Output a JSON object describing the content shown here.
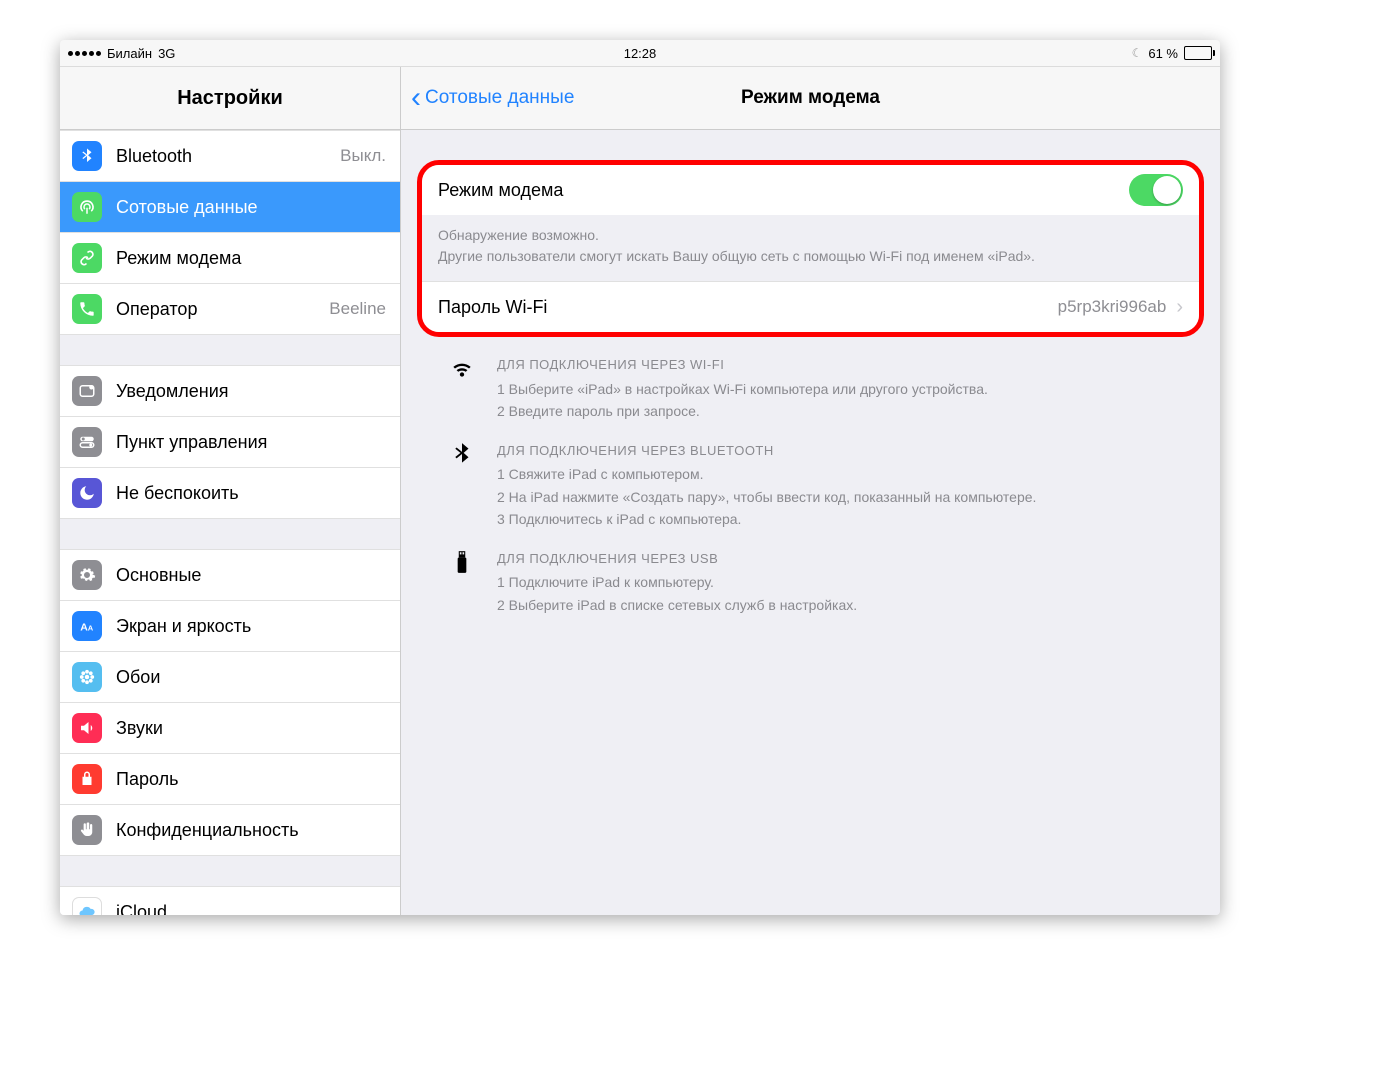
{
  "status": {
    "carrier": "Билайн",
    "network": "3G",
    "time": "12:28",
    "battery_pct": "61 %",
    "battery_level": 61
  },
  "sidebar": {
    "title": "Настройки",
    "groups": [
      {
        "rows": [
          {
            "id": "bluetooth",
            "label": "Bluetooth",
            "value": "Выкл.",
            "icon": "bluetooth",
            "color": "#2183ff"
          },
          {
            "id": "cellular",
            "label": "Сотовые данные",
            "icon": "antenna",
            "color": "#4cd964",
            "selected": true
          },
          {
            "id": "hotspot",
            "label": "Режим модема",
            "icon": "link",
            "color": "#4cd964"
          },
          {
            "id": "carrier",
            "label": "Оператор",
            "value": "Beeline",
            "icon": "phone",
            "color": "#4cd964"
          }
        ]
      },
      {
        "rows": [
          {
            "id": "notif",
            "label": "Уведомления",
            "icon": "notif",
            "color": "#8e8e93"
          },
          {
            "id": "control",
            "label": "Пункт управления",
            "icon": "switches",
            "color": "#8e8e93"
          },
          {
            "id": "dnd",
            "label": "Не беспокоить",
            "icon": "moon",
            "color": "#5856d6"
          }
        ]
      },
      {
        "rows": [
          {
            "id": "general",
            "label": "Основные",
            "icon": "gear",
            "color": "#8e8e93"
          },
          {
            "id": "display",
            "label": "Экран и яркость",
            "icon": "aa",
            "color": "#2183ff"
          },
          {
            "id": "wallpaper",
            "label": "Обои",
            "icon": "flower",
            "color": "#55bef0"
          },
          {
            "id": "sounds",
            "label": "Звуки",
            "icon": "speaker",
            "color": "#ff2d55"
          },
          {
            "id": "passcode",
            "label": "Пароль",
            "icon": "lock",
            "color": "#ff3b30"
          },
          {
            "id": "privacy",
            "label": "Конфиденциальность",
            "icon": "hand",
            "color": "#8e8e93"
          }
        ]
      },
      {
        "rows": [
          {
            "id": "icloud",
            "label": "iCloud",
            "icon": "cloud",
            "color": "#ffffff"
          }
        ]
      }
    ]
  },
  "detail": {
    "back": "Сотовые данные",
    "title": "Режим модема",
    "hotspot_label": "Режим модема",
    "hotspot_on": true,
    "footer_line1": "Обнаружение возможно.",
    "footer_line2": "Другие пользователи смогут искать Вашу общую сеть с помощью Wi-Fi под именем «iPad».",
    "password_label": "Пароль Wi-Fi",
    "password_value": "p5rp3kri996ab",
    "instructions": [
      {
        "icon": "wifi",
        "heading": "ДЛЯ ПОДКЛЮЧЕНИЯ ЧЕРЕЗ WI-FI",
        "lines": [
          "1 Выберите «iPad» в настройках Wi-Fi компьютера или другого устройства.",
          "2 Введите пароль при запросе."
        ]
      },
      {
        "icon": "bluetooth",
        "heading": "ДЛЯ ПОДКЛЮЧЕНИЯ ЧЕРЕЗ BLUETOOTH",
        "lines": [
          "1 Свяжите iPad с компьютером.",
          "2 На iPad нажмите «Создать пару», чтобы ввести код, показанный на компьютере.",
          "3 Подключитесь к iPad с компьютера."
        ]
      },
      {
        "icon": "usb",
        "heading": "ДЛЯ ПОДКЛЮЧЕНИЯ ЧЕРЕЗ USB",
        "lines": [
          "1 Подключите iPad к компьютеру.",
          "2 Выберите iPad в списке сетевых служб в настройках."
        ]
      }
    ]
  }
}
